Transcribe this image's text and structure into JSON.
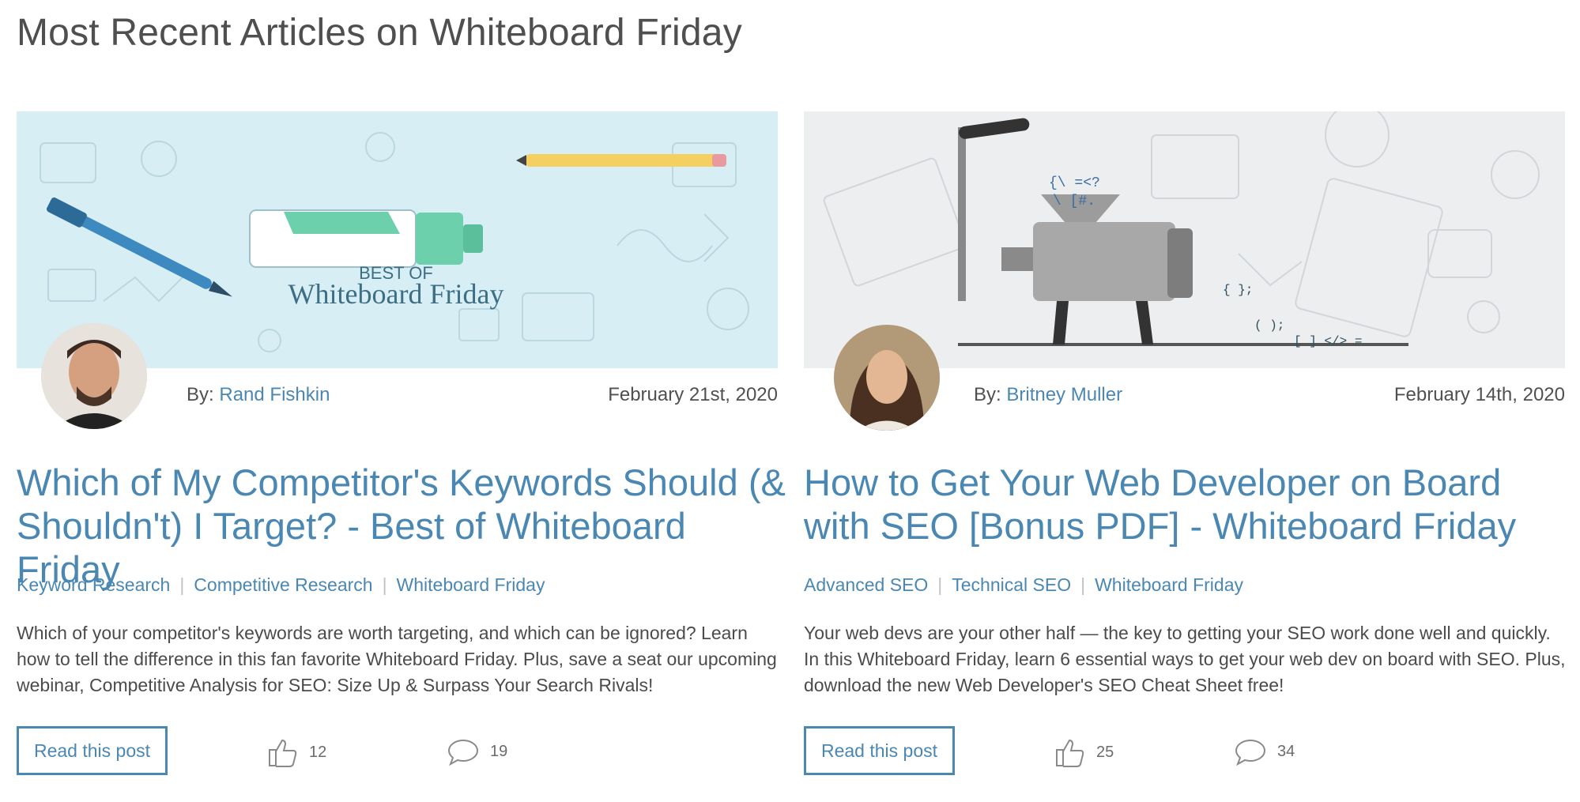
{
  "page": {
    "title": "Most Recent Articles on Whiteboard Friday"
  },
  "articles": [
    {
      "hero_caption_top": "BEST OF",
      "hero_caption_main": "Whiteboard Friday",
      "by_label": "By:",
      "author": "Rand Fishkin",
      "date": "February 21st, 2020",
      "title": "Which of My Competitor's Keywords Should (& Shouldn't) I Target? - Best of Whiteboard Friday",
      "tags": [
        "Keyword Research",
        "Competitive Research",
        "Whiteboard Friday"
      ],
      "excerpt": "Which of your competitor's keywords are worth targeting, and which can be ignored? Learn how to tell the difference in this fan favorite Whiteboard Friday. Plus, save a seat our upcoming webinar, Competitive Analysis for SEO: Size Up & Surpass Your Search Rivals!",
      "read_label": "Read this post",
      "likes": "12",
      "comments": "19"
    },
    {
      "by_label": "By:",
      "author": "Britney Muller",
      "date": "February 14th, 2020",
      "title": "How to Get Your Web Developer on Board with SEO [Bonus PDF] - Whiteboard Friday",
      "tags": [
        "Advanced SEO",
        "Technical SEO",
        "Whiteboard Friday"
      ],
      "excerpt": "Your web devs are your other half — the key to getting your SEO work done well and quickly. In this Whiteboard Friday, learn 6 essential ways to get your web dev on board with SEO. Plus, download the new Web Developer's SEO Cheat Sheet free!",
      "read_label": "Read this post",
      "likes": "25",
      "comments": "34"
    }
  ],
  "colors": {
    "link": "#4a87b2",
    "text": "#4b4b4b",
    "hero_left_bg": "#d8eef5",
    "hero_right_bg": "#eceef0"
  }
}
